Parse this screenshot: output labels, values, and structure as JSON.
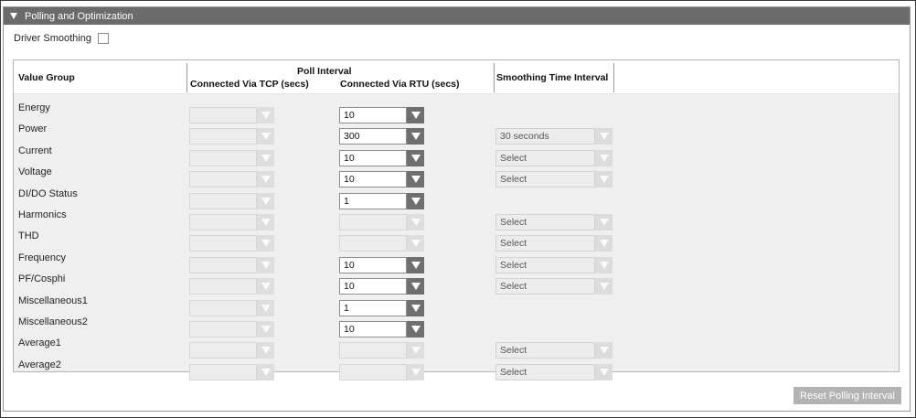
{
  "section": {
    "title": "Polling and Optimization"
  },
  "driver_smoothing": {
    "label": "Driver Smoothing",
    "checked": false
  },
  "table": {
    "headers": {
      "value_group": "Value Group",
      "poll_interval": "Poll Interval",
      "tcp": "Connected Via TCP (secs)",
      "rtu": "Connected Via RTU (secs)",
      "smoothing": "Smoothing Time Interval"
    },
    "rows": [
      {
        "label": "Energy",
        "tcp": "",
        "rtu": "10",
        "smoothing": null
      },
      {
        "label": "Power",
        "tcp": "",
        "rtu": "300",
        "smoothing": "30 seconds"
      },
      {
        "label": "Current",
        "tcp": "",
        "rtu": "10",
        "smoothing": "Select"
      },
      {
        "label": "Voltage",
        "tcp": "",
        "rtu": "10",
        "smoothing": "Select"
      },
      {
        "label": "DI/DO Status",
        "tcp": "",
        "rtu": "1",
        "smoothing": null
      },
      {
        "label": "Harmonics",
        "tcp": "",
        "rtu": "",
        "smoothing": "Select"
      },
      {
        "label": "THD",
        "tcp": "",
        "rtu": "",
        "smoothing": "Select"
      },
      {
        "label": "Frequency",
        "tcp": "",
        "rtu": "10",
        "smoothing": "Select"
      },
      {
        "label": "PF/Cosphi",
        "tcp": "",
        "rtu": "10",
        "smoothing": "Select"
      },
      {
        "label": "Miscellaneous1",
        "tcp": "",
        "rtu": "1",
        "smoothing": null
      },
      {
        "label": "Miscellaneous2",
        "tcp": "",
        "rtu": "10",
        "smoothing": null
      },
      {
        "label": "Average1",
        "tcp": "",
        "rtu": "",
        "smoothing": "Select"
      },
      {
        "label": "Average2",
        "tcp": "",
        "rtu": "",
        "smoothing": "Select"
      }
    ]
  },
  "buttons": {
    "reset": "Reset Polling Interval"
  },
  "icons": {
    "collapse": "triangle-down-icon",
    "dropdown": "chevron-down-icon"
  },
  "colors": {
    "header_bar": "#6b6b6b",
    "active_arrow": "#6f6f6f",
    "button": "#b3b3b3"
  }
}
